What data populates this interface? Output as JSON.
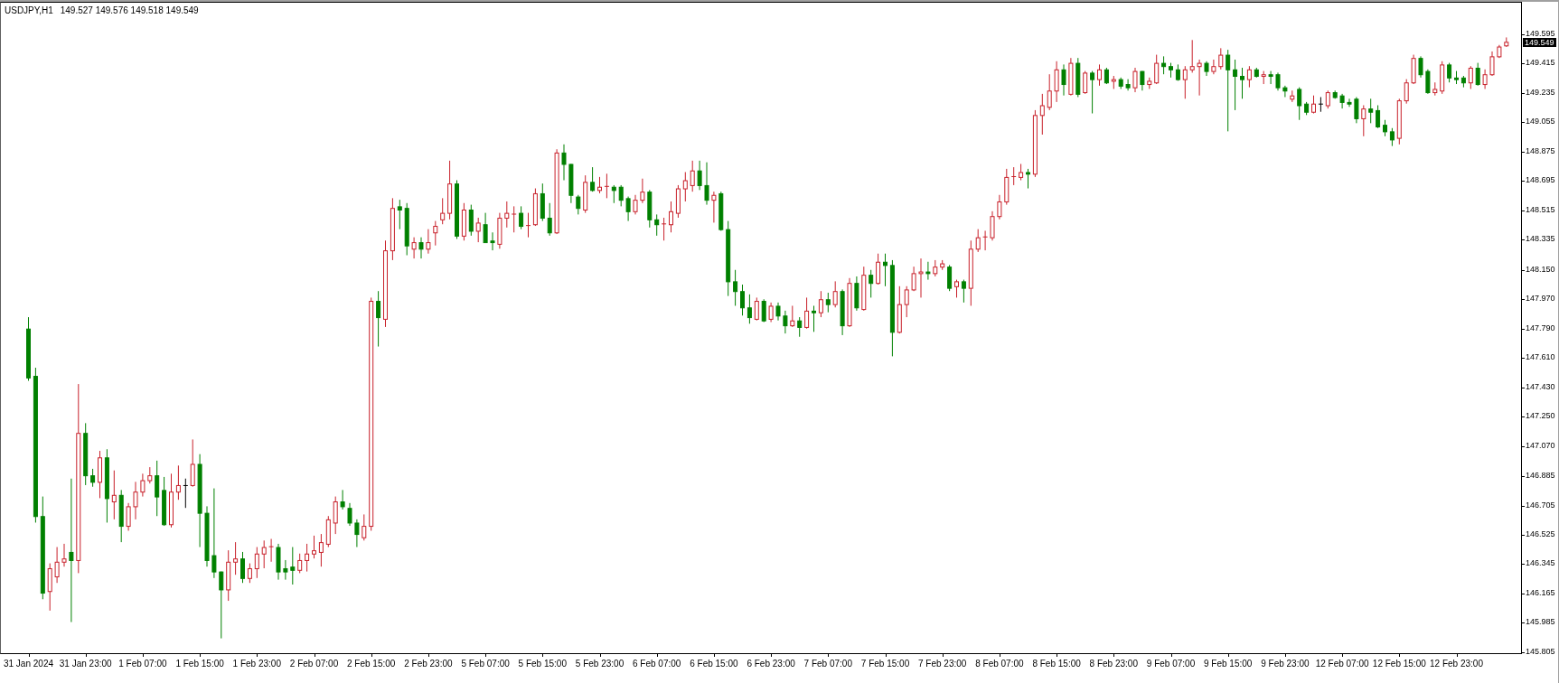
{
  "chart": {
    "symbol": "USDJPY,H1",
    "quote": "149.527 149.576 149.518 149.549",
    "current_price": "149.549",
    "chart_data": {
      "type": "candlestick",
      "ylim": [
        145.799,
        149.789
      ],
      "yticks": [
        149.595,
        149.415,
        149.235,
        149.055,
        148.875,
        148.695,
        148.515,
        148.335,
        {
          "value": 148.15,
          "label": "148.150"
        },
        {
          "value": 147.97,
          "label": "147.970"
        },
        {
          "value": 147.79,
          "label": "147.790"
        },
        {
          "value": 147.61,
          "label": "147.610"
        },
        {
          "value": 147.43,
          "label": "147.430"
        },
        {
          "value": 147.25,
          "label": "147.250"
        },
        {
          "value": 147.07,
          "label": "147.070"
        },
        146.885,
        146.705,
        146.525,
        146.345,
        146.165,
        145.985,
        145.805
      ],
      "categories": [
        "31 Jan 2024",
        null,
        null,
        null,
        null,
        null,
        null,
        null,
        "31 Jan 23:00",
        null,
        null,
        null,
        null,
        null,
        null,
        null,
        "1 Feb 07:00",
        null,
        null,
        null,
        null,
        null,
        null,
        null,
        "1 Feb 15:00",
        null,
        null,
        null,
        null,
        null,
        null,
        null,
        "1 Feb 23:00",
        null,
        null,
        null,
        null,
        null,
        null,
        null,
        "2 Feb 07:00",
        null,
        null,
        null,
        null,
        null,
        null,
        null,
        "2 Feb 15:00",
        null,
        null,
        null,
        null,
        null,
        null,
        null,
        "2 Feb 23:00",
        null,
        null,
        null,
        null,
        null,
        null,
        null,
        "5 Feb 07:00",
        null,
        null,
        null,
        null,
        null,
        null,
        null,
        "5 Feb 15:00",
        null,
        null,
        null,
        null,
        null,
        null,
        null,
        "5 Feb 23:00",
        null,
        null,
        null,
        null,
        null,
        null,
        null,
        "6 Feb 07:00",
        null,
        null,
        null,
        null,
        null,
        null,
        null,
        "6 Feb 15:00",
        null,
        null,
        null,
        null,
        null,
        null,
        null,
        "6 Feb 23:00",
        null,
        null,
        null,
        null,
        null,
        null,
        null,
        "7 Feb 07:00",
        null,
        null,
        null,
        null,
        null,
        null,
        null,
        "7 Feb 15:00",
        null,
        null,
        null,
        null,
        null,
        null,
        null,
        "7 Feb 23:00",
        null,
        null,
        null,
        null,
        null,
        null,
        null,
        "8 Feb 07:00",
        null,
        null,
        null,
        null,
        null,
        null,
        null,
        "8 Feb 15:00",
        null,
        null,
        null,
        null,
        null,
        null,
        null,
        "8 Feb 23:00",
        null,
        null,
        null,
        null,
        null,
        null,
        null,
        "9 Feb 07:00",
        null,
        null,
        null,
        null,
        null,
        null,
        null,
        "9 Feb 15:00",
        null,
        null,
        null,
        null,
        null,
        null,
        null,
        "9 Feb 23:00",
        null,
        null,
        null,
        null,
        null,
        null,
        null,
        "12 Feb 07:00",
        null,
        null,
        null,
        null,
        null,
        null,
        null,
        "12 Feb 15:00",
        null,
        null,
        null,
        null,
        null,
        null,
        null,
        "12 Feb 23:00",
        null,
        null,
        null,
        null,
        null,
        null,
        null
      ],
      "ohlc": [
        [
          147.79,
          147.86,
          147.47,
          147.49
        ],
        [
          147.5,
          147.55,
          146.6,
          146.64
        ],
        [
          146.64,
          146.76,
          146.13,
          146.17
        ],
        [
          146.18,
          146.35,
          146.06,
          146.32
        ],
        [
          146.27,
          146.45,
          146.23,
          146.36
        ],
        [
          146.36,
          146.47,
          146.33,
          146.38
        ],
        [
          146.42,
          146.87,
          145.99,
          146.37
        ],
        [
          146.37,
          147.45,
          146.29,
          147.15
        ],
        [
          147.15,
          147.21,
          146.83,
          146.89
        ],
        [
          146.89,
          146.93,
          146.82,
          146.85
        ],
        [
          146.85,
          147.04,
          146.75,
          147.0
        ],
        [
          147.0,
          147.05,
          146.6,
          146.75
        ],
        [
          146.73,
          146.92,
          146.62,
          146.77
        ],
        [
          146.77,
          146.8,
          146.48,
          146.58
        ],
        [
          146.58,
          146.72,
          146.55,
          146.7
        ],
        [
          146.7,
          146.85,
          146.62,
          146.79
        ],
        [
          146.79,
          146.9,
          146.76,
          146.86
        ],
        [
          146.86,
          146.94,
          146.84,
          146.89
        ],
        [
          146.89,
          146.98,
          146.64,
          146.76
        ],
        [
          146.8,
          146.88,
          146.58,
          146.59
        ],
        [
          146.59,
          146.9,
          146.57,
          146.79
        ],
        [
          146.79,
          146.95,
          146.74,
          146.83
        ],
        [
          146.83,
          146.87,
          146.69,
          146.83
        ],
        [
          146.83,
          147.11,
          146.82,
          146.96
        ],
        [
          146.96,
          147.02,
          146.45,
          146.66
        ],
        [
          146.66,
          146.7,
          146.33,
          146.37
        ],
        [
          146.4,
          146.81,
          146.26,
          146.3
        ],
        [
          146.3,
          146.3,
          145.89,
          146.19
        ],
        [
          146.19,
          146.43,
          146.12,
          146.36
        ],
        [
          146.36,
          146.48,
          146.28,
          146.38
        ],
        [
          146.38,
          146.42,
          146.23,
          146.26
        ],
        [
          146.26,
          146.35,
          146.23,
          146.32
        ],
        [
          146.32,
          146.45,
          146.26,
          146.41
        ],
        [
          146.41,
          146.49,
          146.32,
          146.45
        ],
        [
          146.45,
          146.5,
          146.36,
          146.455
        ],
        [
          146.45,
          146.47,
          146.25,
          146.3
        ],
        [
          146.32,
          146.37,
          146.25,
          146.3
        ],
        [
          146.33,
          146.45,
          146.22,
          146.31
        ],
        [
          146.31,
          146.41,
          146.29,
          146.37
        ],
        [
          146.37,
          146.47,
          146.3,
          146.41
        ],
        [
          146.41,
          146.52,
          146.38,
          146.43
        ],
        [
          146.42,
          146.53,
          146.33,
          146.48
        ],
        [
          146.47,
          146.64,
          146.45,
          146.62
        ],
        [
          146.6,
          146.76,
          146.53,
          146.73
        ],
        [
          146.73,
          146.8,
          146.68,
          146.7
        ],
        [
          146.69,
          146.72,
          146.58,
          146.6
        ],
        [
          146.6,
          146.62,
          146.45,
          146.53
        ],
        [
          146.51,
          146.65,
          146.49,
          146.58
        ],
        [
          146.58,
          147.98,
          146.55,
          147.96
        ],
        [
          147.96,
          148.02,
          147.68,
          147.86
        ],
        [
          147.85,
          148.33,
          147.8,
          148.27
        ],
        [
          148.27,
          148.59,
          148.21,
          148.53
        ],
        [
          148.54,
          148.58,
          148.4,
          148.52
        ],
        [
          148.53,
          148.56,
          148.24,
          148.3
        ],
        [
          148.28,
          148.35,
          148.22,
          148.32
        ],
        [
          148.32,
          148.35,
          148.22,
          148.28
        ],
        [
          148.28,
          148.4,
          148.25,
          148.32
        ],
        [
          148.38,
          148.45,
          148.3,
          148.42
        ],
        [
          148.46,
          148.59,
          148.43,
          148.5
        ],
        [
          148.5,
          148.82,
          148.46,
          148.68
        ],
        [
          148.68,
          148.7,
          148.34,
          148.36
        ],
        [
          148.36,
          148.56,
          148.33,
          148.52
        ],
        [
          148.52,
          148.55,
          148.36,
          148.39
        ],
        [
          148.39,
          148.47,
          148.32,
          148.44
        ],
        [
          148.43,
          148.5,
          148.32,
          148.32
        ],
        [
          148.33,
          148.38,
          148.27,
          148.32
        ],
        [
          148.31,
          148.5,
          148.28,
          148.47
        ],
        [
          148.47,
          148.57,
          148.41,
          148.5
        ],
        [
          148.49,
          148.54,
          148.38,
          148.495
        ],
        [
          148.5,
          148.54,
          148.4,
          148.42
        ],
        [
          148.42,
          148.5,
          148.35,
          148.425
        ],
        [
          148.43,
          148.65,
          148.42,
          148.62
        ],
        [
          148.62,
          148.68,
          148.45,
          148.47
        ],
        [
          148.47,
          148.56,
          148.36,
          148.38
        ],
        [
          148.38,
          148.89,
          148.37,
          148.87
        ],
        [
          148.87,
          148.92,
          148.7,
          148.8
        ],
        [
          148.8,
          148.8,
          148.56,
          148.61
        ],
        [
          148.6,
          148.61,
          148.49,
          148.53
        ],
        [
          148.52,
          148.73,
          148.5,
          148.69
        ],
        [
          148.69,
          148.78,
          148.63,
          148.64
        ],
        [
          148.64,
          148.72,
          148.62,
          148.66
        ],
        [
          148.66,
          148.74,
          148.59,
          148.665
        ],
        [
          148.66,
          148.67,
          148.56,
          148.64
        ],
        [
          148.66,
          148.67,
          148.54,
          148.58
        ],
        [
          148.59,
          148.6,
          148.45,
          148.51
        ],
        [
          148.51,
          148.61,
          148.49,
          148.58
        ],
        [
          148.58,
          148.71,
          148.56,
          148.63
        ],
        [
          148.63,
          148.64,
          148.41,
          148.46
        ],
        [
          148.46,
          148.49,
          148.36,
          148.43
        ],
        [
          148.43,
          148.47,
          148.33,
          148.435
        ],
        [
          148.43,
          148.57,
          148.38,
          148.51
        ],
        [
          148.5,
          148.67,
          148.47,
          148.65
        ],
        [
          148.65,
          148.75,
          148.57,
          148.7
        ],
        [
          148.67,
          148.82,
          148.63,
          148.76
        ],
        [
          148.76,
          148.82,
          148.64,
          148.67
        ],
        [
          148.67,
          148.81,
          148.55,
          148.58
        ],
        [
          148.58,
          148.63,
          148.44,
          148.61
        ],
        [
          148.62,
          148.63,
          148.39,
          148.4
        ],
        [
          148.4,
          148.45,
          147.99,
          148.08
        ],
        [
          148.08,
          148.15,
          147.93,
          148.02
        ],
        [
          148.02,
          148.06,
          147.87,
          147.92
        ],
        [
          147.92,
          148.0,
          147.82,
          147.86
        ],
        [
          147.85,
          147.98,
          147.84,
          147.96
        ],
        [
          147.96,
          147.97,
          147.83,
          147.84
        ],
        [
          147.85,
          147.95,
          147.83,
          147.93
        ],
        [
          147.93,
          147.95,
          147.84,
          147.87
        ],
        [
          147.87,
          147.9,
          147.76,
          147.81
        ],
        [
          147.81,
          147.93,
          147.8,
          147.84
        ],
        [
          147.84,
          147.86,
          147.74,
          147.8
        ],
        [
          147.8,
          147.98,
          147.79,
          147.9
        ],
        [
          147.9,
          147.93,
          147.77,
          147.89
        ],
        [
          147.89,
          148.02,
          147.86,
          147.97
        ],
        [
          147.97,
          148.01,
          147.89,
          147.94
        ],
        [
          147.94,
          148.08,
          147.92,
          148.02
        ],
        [
          148.02,
          148.03,
          147.75,
          147.81
        ],
        [
          147.81,
          148.1,
          147.8,
          148.07
        ],
        [
          148.07,
          148.11,
          147.9,
          147.92
        ],
        [
          147.91,
          148.17,
          147.9,
          148.12
        ],
        [
          148.12,
          148.15,
          147.98,
          148.07
        ],
        [
          148.07,
          148.25,
          148.06,
          148.2
        ],
        [
          148.2,
          148.25,
          148.05,
          148.18
        ],
        [
          148.18,
          148.21,
          147.62,
          147.77
        ],
        [
          147.77,
          148.05,
          147.76,
          147.94
        ],
        [
          147.94,
          148.05,
          147.86,
          148.03
        ],
        [
          148.03,
          148.17,
          148.02,
          148.13
        ],
        [
          148.13,
          148.22,
          147.98,
          148.14
        ],
        [
          148.14,
          148.2,
          148.09,
          148.13
        ],
        [
          148.13,
          148.21,
          148.11,
          148.17
        ],
        [
          148.17,
          148.21,
          148.15,
          148.19
        ],
        [
          148.17,
          148.18,
          148.02,
          148.04
        ],
        [
          148.05,
          148.09,
          147.98,
          148.08
        ],
        [
          148.08,
          148.09,
          147.95,
          148.04
        ],
        [
          148.04,
          148.33,
          147.93,
          148.28
        ],
        [
          148.28,
          148.4,
          148.26,
          148.35
        ],
        [
          148.35,
          148.39,
          148.27,
          148.355
        ],
        [
          148.35,
          148.51,
          148.33,
          148.48
        ],
        [
          148.48,
          148.61,
          148.46,
          148.57
        ],
        [
          148.57,
          148.77,
          148.55,
          148.72
        ],
        [
          148.72,
          148.78,
          148.67,
          148.725
        ],
        [
          148.72,
          148.8,
          148.7,
          148.75
        ],
        [
          148.75,
          148.77,
          148.65,
          148.74
        ],
        [
          148.74,
          149.13,
          148.72,
          149.1
        ],
        [
          149.1,
          149.23,
          148.98,
          149.16
        ],
        [
          149.15,
          149.35,
          149.13,
          149.25
        ],
        [
          149.25,
          149.43,
          149.18,
          149.38
        ],
        [
          149.38,
          149.41,
          149.22,
          149.29
        ],
        [
          149.23,
          149.45,
          149.22,
          149.42
        ],
        [
          149.42,
          149.45,
          149.21,
          149.23
        ],
        [
          149.24,
          149.37,
          149.23,
          149.36
        ],
        [
          149.36,
          149.37,
          149.11,
          149.32
        ],
        [
          149.32,
          149.41,
          149.28,
          149.38
        ],
        [
          149.38,
          149.39,
          149.29,
          149.3
        ],
        [
          149.31,
          149.34,
          149.26,
          149.32
        ],
        [
          149.32,
          149.33,
          149.26,
          149.28
        ],
        [
          149.29,
          149.32,
          149.25,
          149.27
        ],
        [
          149.27,
          149.39,
          149.24,
          149.37
        ],
        [
          149.37,
          149.37,
          149.25,
          149.29
        ],
        [
          149.29,
          149.33,
          149.26,
          149.31
        ],
        [
          149.3,
          149.47,
          149.29,
          149.42
        ],
        [
          149.42,
          149.46,
          149.35,
          149.4
        ],
        [
          149.4,
          149.42,
          149.33,
          149.38
        ],
        [
          149.38,
          149.41,
          149.31,
          149.32
        ],
        [
          149.32,
          149.4,
          149.2,
          149.38
        ],
        [
          149.38,
          149.56,
          149.36,
          149.4
        ],
        [
          149.4,
          149.44,
          149.22,
          149.42
        ],
        [
          149.42,
          149.43,
          149.34,
          149.37
        ],
        [
          149.37,
          149.44,
          149.35,
          149.4
        ],
        [
          149.4,
          149.51,
          149.38,
          149.47
        ],
        [
          149.47,
          149.5,
          149.0,
          149.38
        ],
        [
          149.38,
          149.44,
          149.13,
          149.34
        ],
        [
          149.34,
          149.39,
          149.2,
          149.32
        ],
        [
          149.32,
          149.4,
          149.27,
          149.38
        ],
        [
          149.38,
          149.39,
          149.33,
          149.34
        ],
        [
          149.34,
          149.37,
          149.29,
          149.35
        ],
        [
          149.35,
          149.37,
          149.29,
          149.34
        ],
        [
          149.35,
          149.36,
          149.25,
          149.27
        ],
        [
          149.27,
          149.28,
          149.21,
          149.25
        ],
        [
          149.2,
          149.25,
          149.18,
          149.22
        ],
        [
          149.26,
          149.27,
          149.07,
          149.16
        ],
        [
          149.17,
          149.18,
          149.1,
          149.12
        ],
        [
          149.12,
          149.22,
          149.11,
          149.17
        ],
        [
          149.17,
          149.21,
          149.12,
          149.17
        ],
        [
          149.16,
          149.25,
          149.14,
          149.24
        ],
        [
          149.24,
          149.25,
          149.2,
          149.21
        ],
        [
          149.22,
          149.23,
          149.14,
          149.18
        ],
        [
          149.18,
          149.2,
          149.15,
          149.17
        ],
        [
          149.2,
          149.21,
          149.05,
          149.08
        ],
        [
          149.08,
          149.16,
          148.97,
          149.14
        ],
        [
          149.14,
          149.2,
          149.05,
          149.12
        ],
        [
          149.13,
          149.16,
          149.02,
          149.03
        ],
        [
          149.04,
          149.07,
          148.97,
          149.0
        ],
        [
          149.0,
          149.02,
          148.91,
          148.95
        ],
        [
          148.96,
          149.2,
          148.92,
          149.19
        ],
        [
          149.19,
          149.32,
          149.17,
          149.3
        ],
        [
          149.3,
          149.47,
          149.29,
          149.45
        ],
        [
          149.45,
          149.46,
          149.33,
          149.35
        ],
        [
          149.37,
          149.38,
          149.23,
          149.24
        ],
        [
          149.24,
          149.3,
          149.22,
          149.26
        ],
        [
          149.25,
          149.43,
          149.23,
          149.41
        ],
        [
          149.41,
          149.42,
          149.3,
          149.33
        ],
        [
          149.33,
          149.37,
          149.29,
          149.32
        ],
        [
          149.33,
          149.34,
          149.27,
          149.3
        ],
        [
          149.3,
          149.4,
          149.26,
          149.39
        ],
        [
          149.39,
          149.42,
          149.28,
          149.29
        ],
        [
          149.29,
          149.38,
          149.26,
          149.35
        ],
        [
          149.35,
          149.49,
          149.34,
          149.46
        ],
        [
          149.46,
          149.53,
          149.45,
          149.52
        ],
        [
          149.527,
          149.576,
          149.518,
          149.549
        ]
      ]
    }
  }
}
